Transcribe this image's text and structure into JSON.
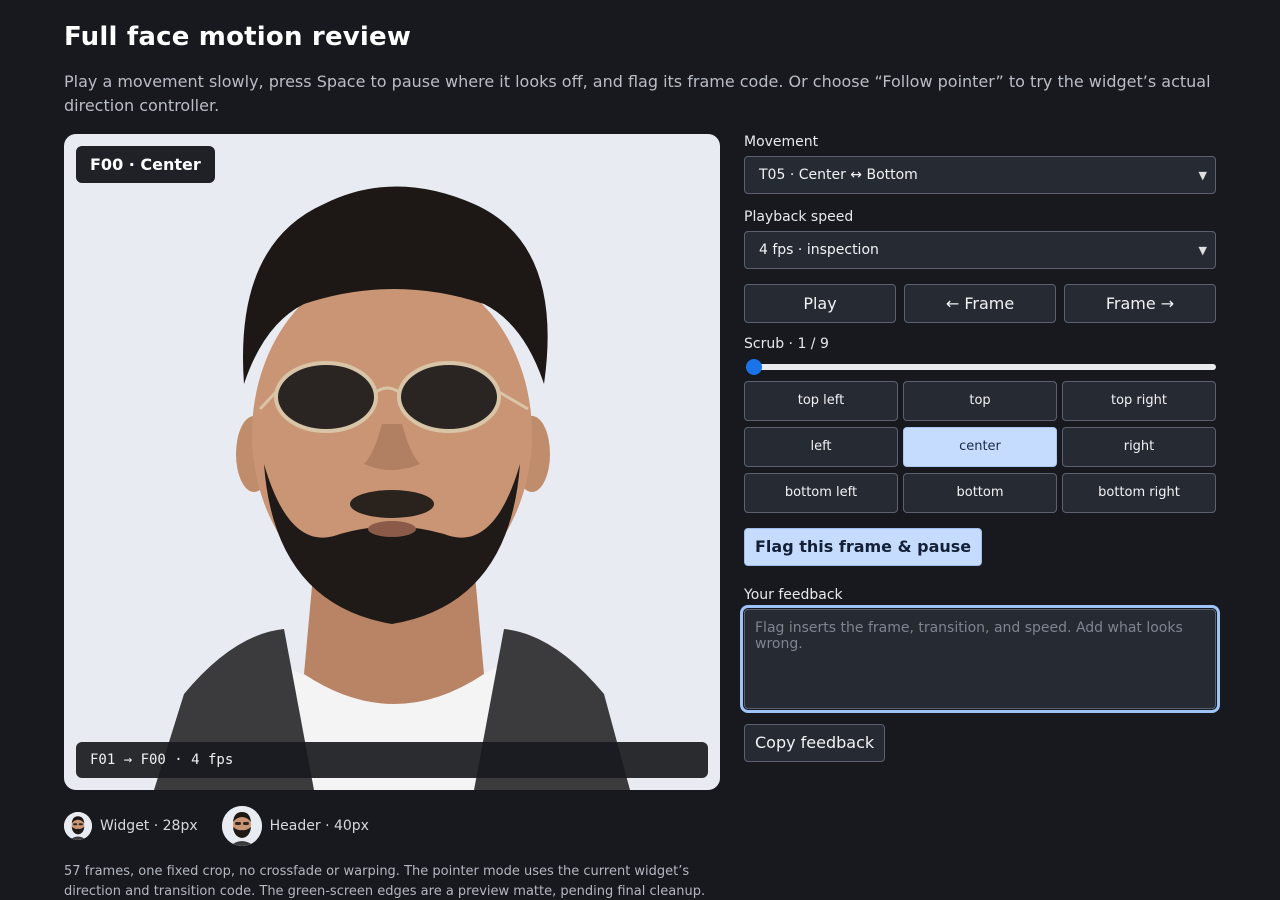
{
  "header": {
    "title": "Full face motion review",
    "subtitle": "Play a movement slowly, press Space to pause where it looks off, and flag its frame code. Or choose “Follow pointer” to try the widget’s actual direction controller."
  },
  "preview": {
    "frame_badge": "F00 · Center",
    "transition_caption": "F01 → F00 · 4 fps"
  },
  "sizes": [
    {
      "label": "Widget · 28px"
    },
    {
      "label": "Header · 40px"
    }
  ],
  "footnote": "57 frames, one fixed crop, no crossfade or warping. The pointer mode uses the current widget’s direction and transition code. The green-screen edges are a preview matte, pending final cleanup.",
  "controls": {
    "movement_label": "Movement",
    "movement_value": "T05 · Center ↔ Bottom",
    "speed_label": "Playback speed",
    "speed_value": "4 fps · inspection",
    "play": "Play",
    "prev_frame": "← Frame",
    "next_frame": "Frame →",
    "scrub_label": "Scrub · 1 / 9",
    "scrub_fraction": 0,
    "directions": [
      "top left",
      "top",
      "top right",
      "left",
      "center",
      "right",
      "bottom left",
      "bottom",
      "bottom right"
    ],
    "active_direction": "center",
    "flag_button": "Flag this frame & pause",
    "feedback_label": "Your feedback",
    "feedback_placeholder": "Flag inserts the frame, transition, and speed. Add what looks wrong.",
    "copy_button": "Copy feedback"
  },
  "colors": {
    "background": "#17191e",
    "accent": "#c5dcff",
    "slider_thumb": "#1a73e8"
  }
}
